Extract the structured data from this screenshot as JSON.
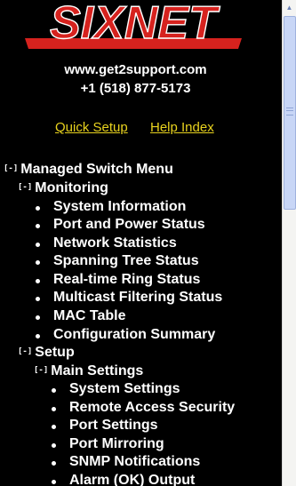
{
  "brand": {
    "name": "SIXNET",
    "accent_color": "#d6221e"
  },
  "contact": {
    "website": "www.get2support.com",
    "phone": "+1 (518) 877-5173"
  },
  "links": {
    "quick_setup": "Quick Setup",
    "help_index": "Help Index",
    "link_color": "#e8d21e"
  },
  "menu": {
    "collapse_glyph": "[-]",
    "title": "Managed Switch Menu",
    "monitoring": {
      "label": "Monitoring",
      "items": [
        "System Information",
        "Port and Power Status",
        "Network Statistics",
        "Spanning Tree Status",
        "Real-time Ring Status",
        "Multicast Filtering Status",
        "MAC Table",
        "Configuration Summary"
      ]
    },
    "setup": {
      "label": "Setup",
      "main_settings": {
        "label": "Main Settings",
        "items": [
          "System Settings",
          "Remote Access Security",
          "Port Settings",
          "Port Mirroring",
          "SNMP Notifications",
          "Alarm (OK) Output"
        ]
      }
    }
  }
}
